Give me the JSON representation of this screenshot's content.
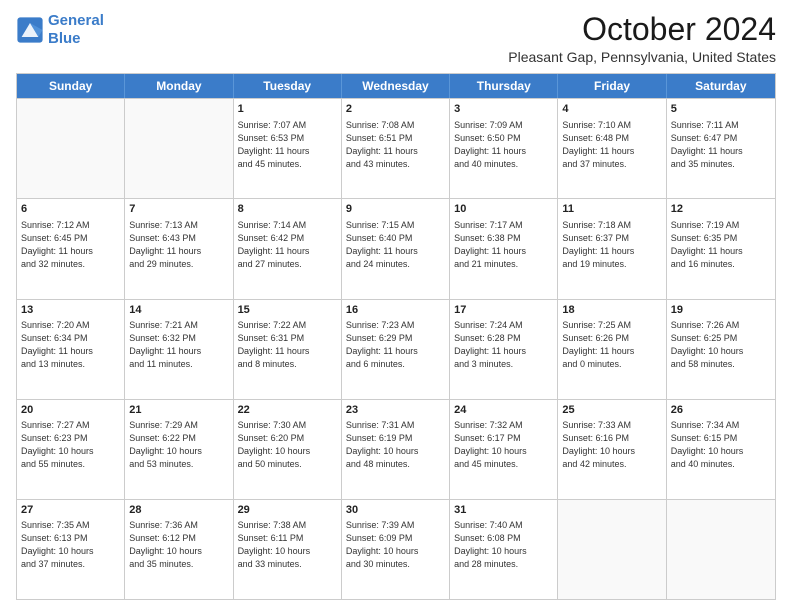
{
  "logo": {
    "line1": "General",
    "line2": "Blue"
  },
  "title": "October 2024",
  "location": "Pleasant Gap, Pennsylvania, United States",
  "days_of_week": [
    "Sunday",
    "Monday",
    "Tuesday",
    "Wednesday",
    "Thursday",
    "Friday",
    "Saturday"
  ],
  "weeks": [
    [
      {
        "day": "",
        "empty": true
      },
      {
        "day": "",
        "empty": true
      },
      {
        "day": "1",
        "line1": "Sunrise: 7:07 AM",
        "line2": "Sunset: 6:53 PM",
        "line3": "Daylight: 11 hours",
        "line4": "and 45 minutes."
      },
      {
        "day": "2",
        "line1": "Sunrise: 7:08 AM",
        "line2": "Sunset: 6:51 PM",
        "line3": "Daylight: 11 hours",
        "line4": "and 43 minutes."
      },
      {
        "day": "3",
        "line1": "Sunrise: 7:09 AM",
        "line2": "Sunset: 6:50 PM",
        "line3": "Daylight: 11 hours",
        "line4": "and 40 minutes."
      },
      {
        "day": "4",
        "line1": "Sunrise: 7:10 AM",
        "line2": "Sunset: 6:48 PM",
        "line3": "Daylight: 11 hours",
        "line4": "and 37 minutes."
      },
      {
        "day": "5",
        "line1": "Sunrise: 7:11 AM",
        "line2": "Sunset: 6:47 PM",
        "line3": "Daylight: 11 hours",
        "line4": "and 35 minutes."
      }
    ],
    [
      {
        "day": "6",
        "line1": "Sunrise: 7:12 AM",
        "line2": "Sunset: 6:45 PM",
        "line3": "Daylight: 11 hours",
        "line4": "and 32 minutes."
      },
      {
        "day": "7",
        "line1": "Sunrise: 7:13 AM",
        "line2": "Sunset: 6:43 PM",
        "line3": "Daylight: 11 hours",
        "line4": "and 29 minutes."
      },
      {
        "day": "8",
        "line1": "Sunrise: 7:14 AM",
        "line2": "Sunset: 6:42 PM",
        "line3": "Daylight: 11 hours",
        "line4": "and 27 minutes."
      },
      {
        "day": "9",
        "line1": "Sunrise: 7:15 AM",
        "line2": "Sunset: 6:40 PM",
        "line3": "Daylight: 11 hours",
        "line4": "and 24 minutes."
      },
      {
        "day": "10",
        "line1": "Sunrise: 7:17 AM",
        "line2": "Sunset: 6:38 PM",
        "line3": "Daylight: 11 hours",
        "line4": "and 21 minutes."
      },
      {
        "day": "11",
        "line1": "Sunrise: 7:18 AM",
        "line2": "Sunset: 6:37 PM",
        "line3": "Daylight: 11 hours",
        "line4": "and 19 minutes."
      },
      {
        "day": "12",
        "line1": "Sunrise: 7:19 AM",
        "line2": "Sunset: 6:35 PM",
        "line3": "Daylight: 11 hours",
        "line4": "and 16 minutes."
      }
    ],
    [
      {
        "day": "13",
        "line1": "Sunrise: 7:20 AM",
        "line2": "Sunset: 6:34 PM",
        "line3": "Daylight: 11 hours",
        "line4": "and 13 minutes."
      },
      {
        "day": "14",
        "line1": "Sunrise: 7:21 AM",
        "line2": "Sunset: 6:32 PM",
        "line3": "Daylight: 11 hours",
        "line4": "and 11 minutes."
      },
      {
        "day": "15",
        "line1": "Sunrise: 7:22 AM",
        "line2": "Sunset: 6:31 PM",
        "line3": "Daylight: 11 hours",
        "line4": "and 8 minutes."
      },
      {
        "day": "16",
        "line1": "Sunrise: 7:23 AM",
        "line2": "Sunset: 6:29 PM",
        "line3": "Daylight: 11 hours",
        "line4": "and 6 minutes."
      },
      {
        "day": "17",
        "line1": "Sunrise: 7:24 AM",
        "line2": "Sunset: 6:28 PM",
        "line3": "Daylight: 11 hours",
        "line4": "and 3 minutes."
      },
      {
        "day": "18",
        "line1": "Sunrise: 7:25 AM",
        "line2": "Sunset: 6:26 PM",
        "line3": "Daylight: 11 hours",
        "line4": "and 0 minutes."
      },
      {
        "day": "19",
        "line1": "Sunrise: 7:26 AM",
        "line2": "Sunset: 6:25 PM",
        "line3": "Daylight: 10 hours",
        "line4": "and 58 minutes."
      }
    ],
    [
      {
        "day": "20",
        "line1": "Sunrise: 7:27 AM",
        "line2": "Sunset: 6:23 PM",
        "line3": "Daylight: 10 hours",
        "line4": "and 55 minutes."
      },
      {
        "day": "21",
        "line1": "Sunrise: 7:29 AM",
        "line2": "Sunset: 6:22 PM",
        "line3": "Daylight: 10 hours",
        "line4": "and 53 minutes."
      },
      {
        "day": "22",
        "line1": "Sunrise: 7:30 AM",
        "line2": "Sunset: 6:20 PM",
        "line3": "Daylight: 10 hours",
        "line4": "and 50 minutes."
      },
      {
        "day": "23",
        "line1": "Sunrise: 7:31 AM",
        "line2": "Sunset: 6:19 PM",
        "line3": "Daylight: 10 hours",
        "line4": "and 48 minutes."
      },
      {
        "day": "24",
        "line1": "Sunrise: 7:32 AM",
        "line2": "Sunset: 6:17 PM",
        "line3": "Daylight: 10 hours",
        "line4": "and 45 minutes."
      },
      {
        "day": "25",
        "line1": "Sunrise: 7:33 AM",
        "line2": "Sunset: 6:16 PM",
        "line3": "Daylight: 10 hours",
        "line4": "and 42 minutes."
      },
      {
        "day": "26",
        "line1": "Sunrise: 7:34 AM",
        "line2": "Sunset: 6:15 PM",
        "line3": "Daylight: 10 hours",
        "line4": "and 40 minutes."
      }
    ],
    [
      {
        "day": "27",
        "line1": "Sunrise: 7:35 AM",
        "line2": "Sunset: 6:13 PM",
        "line3": "Daylight: 10 hours",
        "line4": "and 37 minutes."
      },
      {
        "day": "28",
        "line1": "Sunrise: 7:36 AM",
        "line2": "Sunset: 6:12 PM",
        "line3": "Daylight: 10 hours",
        "line4": "and 35 minutes."
      },
      {
        "day": "29",
        "line1": "Sunrise: 7:38 AM",
        "line2": "Sunset: 6:11 PM",
        "line3": "Daylight: 10 hours",
        "line4": "and 33 minutes."
      },
      {
        "day": "30",
        "line1": "Sunrise: 7:39 AM",
        "line2": "Sunset: 6:09 PM",
        "line3": "Daylight: 10 hours",
        "line4": "and 30 minutes."
      },
      {
        "day": "31",
        "line1": "Sunrise: 7:40 AM",
        "line2": "Sunset: 6:08 PM",
        "line3": "Daylight: 10 hours",
        "line4": "and 28 minutes."
      },
      {
        "day": "",
        "empty": true
      },
      {
        "day": "",
        "empty": true
      }
    ]
  ]
}
